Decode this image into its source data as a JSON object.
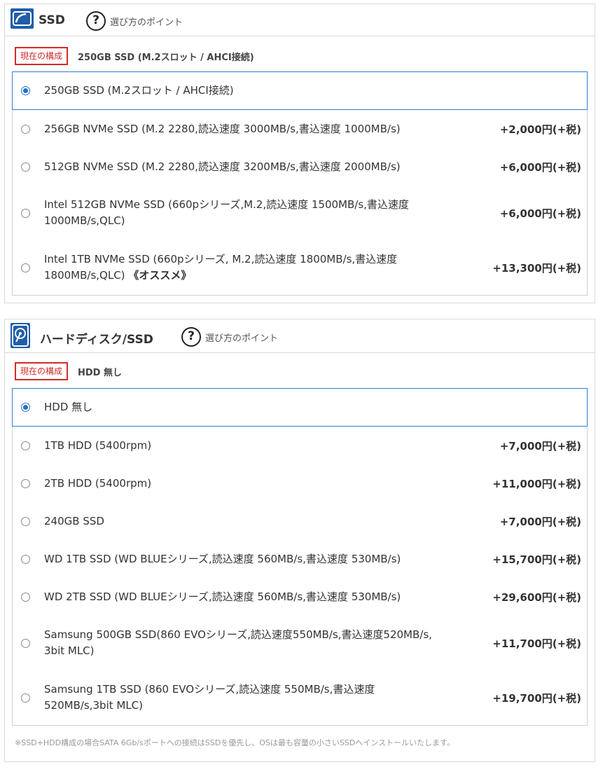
{
  "ssd": {
    "title": "SSD",
    "icon": "ssd-icon",
    "help_label": "選び方のポイント",
    "current_badge": "現在の構成",
    "current_value": "250GB SSD (M.2スロット / AHCI接続)",
    "options": [
      {
        "label": "250GB SSD (M.2スロット / AHCI接続)",
        "price": "",
        "selected": true
      },
      {
        "label": "256GB NVMe SSD (M.2 2280,読込速度 3000MB/s,書込速度 1000MB/s)",
        "price": "+2,000円(+税)",
        "selected": false
      },
      {
        "label": "512GB NVMe SSD (M.2 2280,読込速度 3200MB/s,書込速度 2000MB/s)",
        "price": "+6,000円(+税)",
        "selected": false
      },
      {
        "label": "Intel 512GB NVMe SSD (660pシリーズ,M.2,読込速度 1500MB/s,書込速度 1000MB/s,QLC)",
        "price": "+6,000円(+税)",
        "selected": false
      },
      {
        "label": "Intel 1TB NVMe SSD (660pシリーズ, M.2,読込速度 1800MB/s,書込速度 1800MB/s,QLC) ",
        "label_extra": "《オススメ》",
        "price": "+13,300円(+税)",
        "selected": false
      }
    ]
  },
  "hdd": {
    "title": "ハードディスク/SSD",
    "icon": "hard-disk-icon",
    "help_label": "選び方のポイント",
    "current_badge": "現在の構成",
    "current_value": "HDD 無し",
    "options": [
      {
        "label": "HDD 無し",
        "price": "",
        "selected": true
      },
      {
        "label": "1TB HDD (5400rpm)",
        "price": "+7,000円(+税)",
        "selected": false
      },
      {
        "label": "2TB HDD (5400rpm)",
        "price": "+11,000円(+税)",
        "selected": false
      },
      {
        "label": "240GB SSD",
        "price": "+7,000円(+税)",
        "selected": false
      },
      {
        "label": "WD 1TB SSD (WD BLUEシリーズ,読込速度 560MB/s,書込速度 530MB/s)",
        "price": "+15,700円(+税)",
        "selected": false
      },
      {
        "label": "WD 2TB SSD (WD BLUEシリーズ,読込速度 560MB/s,書込速度 530MB/s)",
        "price": "+29,600円(+税)",
        "selected": false
      },
      {
        "label": "Samsung 500GB SSD(860 EVOシリーズ,読込速度550MB/s,書込速度520MB/s, 3bit MLC)",
        "price": "+11,700円(+税)",
        "selected": false
      },
      {
        "label": "Samsung 1TB SSD (860 EVOシリーズ,読込速度 550MB/s,書込速度 520MB/s,3bit MLC)",
        "price": "+19,700円(+税)",
        "selected": false
      }
    ],
    "note": "※SSD+HDD構成の場合SATA 6Gb/sポートへの接続はSSDを優先し、OSは最も容量の小さいSSDへインストールいたします。"
  },
  "colors": {
    "brand_blue": "#1f5ea9",
    "badge_red": "#d42a2a",
    "selected_border": "#2f7fd1"
  }
}
